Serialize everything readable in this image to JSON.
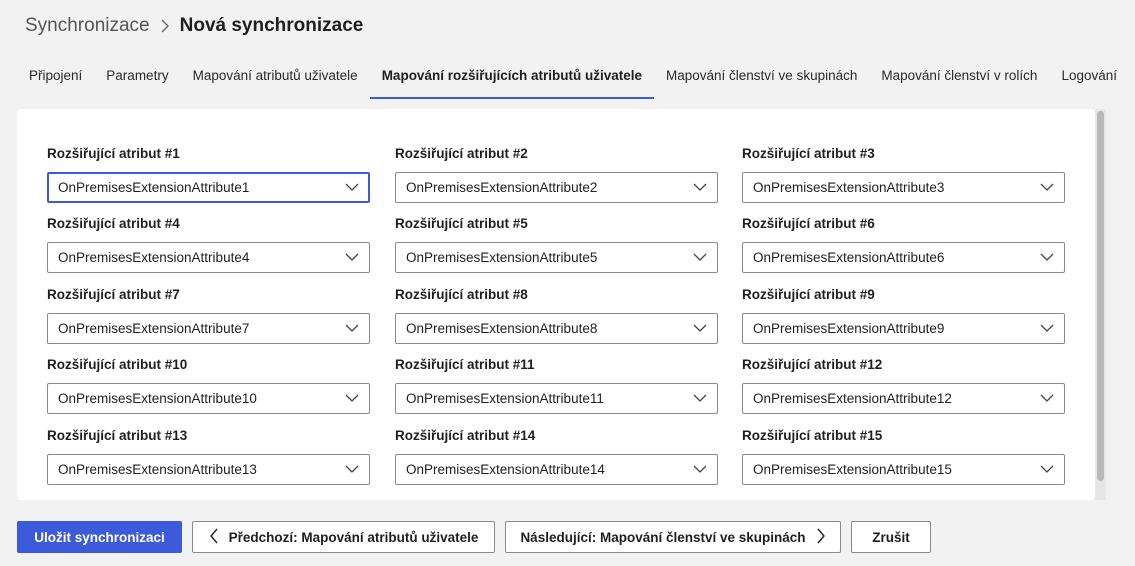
{
  "breadcrumb": {
    "parent": "Synchronizace",
    "current": "Nová synchronizace"
  },
  "tabs": [
    {
      "label": "Připojení",
      "active": false
    },
    {
      "label": "Parametry",
      "active": false
    },
    {
      "label": "Mapování atributů uživatele",
      "active": false
    },
    {
      "label": "Mapování rozšiřujících atributů uživatele",
      "active": true
    },
    {
      "label": "Mapování členství ve skupinách",
      "active": false
    },
    {
      "label": "Mapování členství v rolích",
      "active": false
    },
    {
      "label": "Logování",
      "active": false
    }
  ],
  "fields": [
    {
      "label": "Rozšiřující atribut #1",
      "value": "OnPremisesExtensionAttribute1",
      "focused": true
    },
    {
      "label": "Rozšiřující atribut #2",
      "value": "OnPremisesExtensionAttribute2"
    },
    {
      "label": "Rozšiřující atribut #3",
      "value": "OnPremisesExtensionAttribute3"
    },
    {
      "label": "Rozšiřující atribut #4",
      "value": "OnPremisesExtensionAttribute4"
    },
    {
      "label": "Rozšiřující atribut #5",
      "value": "OnPremisesExtensionAttribute5"
    },
    {
      "label": "Rozšiřující atribut #6",
      "value": "OnPremisesExtensionAttribute6"
    },
    {
      "label": "Rozšiřující atribut #7",
      "value": "OnPremisesExtensionAttribute7"
    },
    {
      "label": "Rozšiřující atribut #8",
      "value": "OnPremisesExtensionAttribute8"
    },
    {
      "label": "Rozšiřující atribut #9",
      "value": "OnPremisesExtensionAttribute9"
    },
    {
      "label": "Rozšiřující atribut #10",
      "value": "OnPremisesExtensionAttribute10"
    },
    {
      "label": "Rozšiřující atribut #11",
      "value": "OnPremisesExtensionAttribute11"
    },
    {
      "label": "Rozšiřující atribut #12",
      "value": "OnPremisesExtensionAttribute12"
    },
    {
      "label": "Rozšiřující atribut #13",
      "value": "OnPremisesExtensionAttribute13"
    },
    {
      "label": "Rozšiřující atribut #14",
      "value": "OnPremisesExtensionAttribute14"
    },
    {
      "label": "Rozšiřující atribut #15",
      "value": "OnPremisesExtensionAttribute15"
    }
  ],
  "footer": {
    "save_label": "Uložit synchronizaci",
    "prev_label": "Předchozí: Mapování atributů uživatele",
    "next_label": "Následující: Mapování členství ve skupinách",
    "cancel_label": "Zrušit"
  },
  "colors": {
    "accent": "#3b5bdb",
    "background": "#f2f2f2"
  }
}
